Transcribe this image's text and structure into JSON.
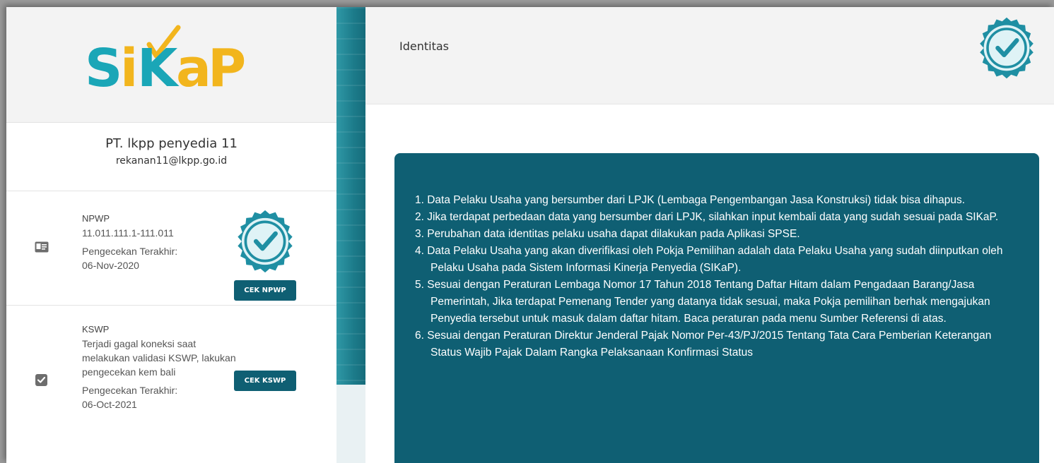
{
  "app": {
    "logo_text": "SiKaP"
  },
  "profile": {
    "company_name": "PT. lkpp penyedia 11",
    "email": "rekanan11@lkpp.go.id"
  },
  "npwp": {
    "label": "NPWP",
    "number": "11.011.111.1-111.011",
    "last_check_label": "Pengecekan Terakhir:",
    "last_check_date": "06-Nov-2020",
    "button_label": "CEK NPWP"
  },
  "kswp": {
    "label": "KSWP",
    "message": "Terjadi gagal koneksi saat melakukan validasi KSWP, lakukan pengecekan kem bali",
    "last_check_label": "Pengecekan Terakhir:",
    "last_check_date": "06-Oct-2021",
    "button_label": "CEK KSWP"
  },
  "main": {
    "title": "Identitas",
    "notices": [
      "1. Data Pelaku Usaha yang bersumber dari LPJK (Lembaga Pengembangan Jasa Konstruksi) tidak bisa dihapus.",
      "2. Jika terdapat perbedaan data yang bersumber dari LPJK, silahkan input kembali data yang sudah sesuai pada SIKaP.",
      "3. Perubahan data identitas pelaku usaha dapat dilakukan pada Aplikasi SPSE.",
      "4. Data Pelaku Usaha yang akan diverifikasi oleh Pokja Pemilihan adalah data Pelaku Usaha yang sudah diinputkan oleh Pelaku Usaha pada Sistem Informasi Kinerja Penyedia (SIKaP).",
      "5. Sesuai dengan Peraturan Lembaga Nomor 17 Tahun 2018 Tentang Daftar Hitam dalam Pengadaan Barang/Jasa Pemerintah, Jika terdapat Pemenang Tender yang datanya tidak sesuai, maka Pokja pemilihan berhak mengajukan Penyedia tersebut untuk masuk dalam daftar hitam. Baca peraturan pada menu Sumber Referensi di atas.",
      "6. Sesuai dengan Peraturan Direktur Jenderal Pajak Nomor Per-43/PJ/2015 Tentang Tata Cara Pemberian Keterangan Status Wajib Pajak Dalam Rangka Pelaksanaan Konfirmasi Status"
    ]
  },
  "colors": {
    "primary": "#0f5f73",
    "logo_teal": "#1aa6b7",
    "logo_gold": "#f2b51d",
    "badge_teal": "#1f8fa3"
  },
  "icons": {
    "npwp": "id-card-icon",
    "kswp": "checkbox-checked-icon",
    "verified": "verified-badge-icon"
  }
}
